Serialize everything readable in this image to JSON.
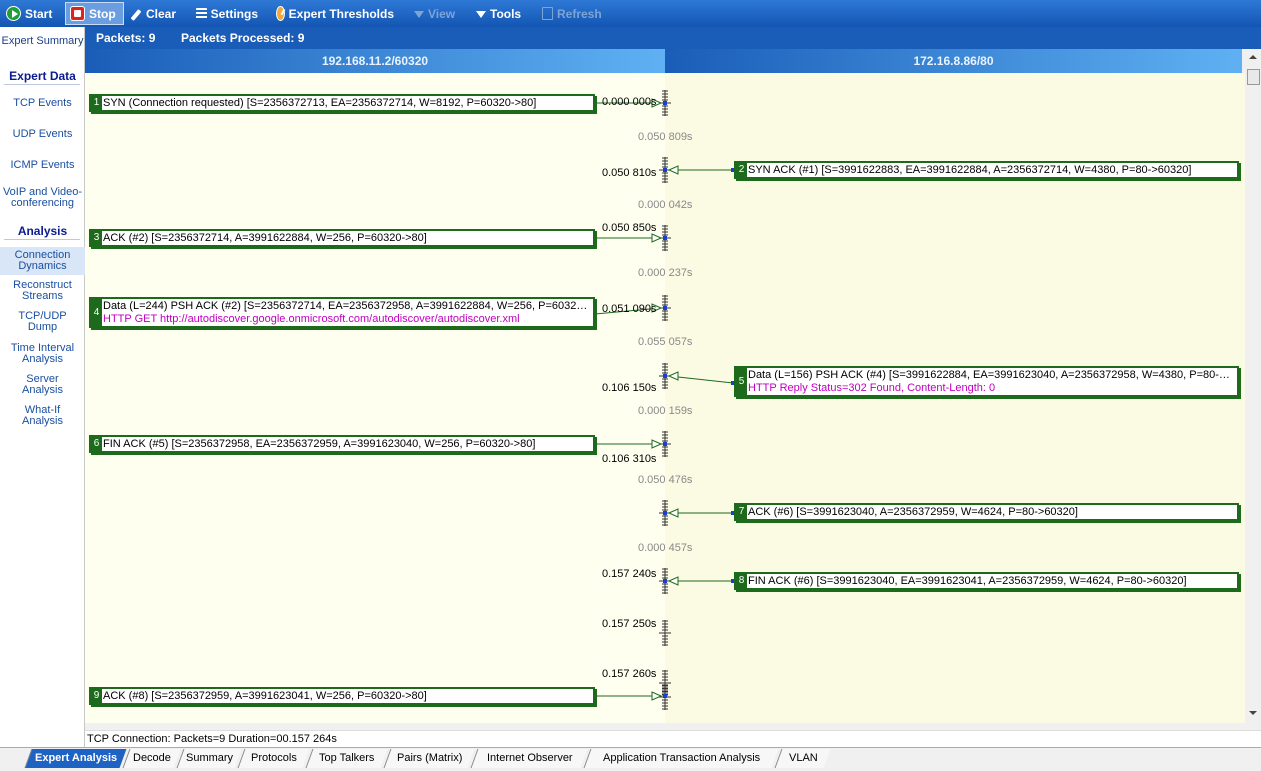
{
  "toolbar": {
    "start": "Start",
    "stop": "Stop",
    "clear": "Clear",
    "settings": "Settings",
    "expert_thresholds": "Expert Thresholds",
    "view": "View",
    "tools": "Tools",
    "refresh": "Refresh"
  },
  "sidebar": {
    "expert_summary": "Expert Summary",
    "expert_data_header": "Expert Data",
    "tcp_events": "TCP Events",
    "udp_events": "UDP Events",
    "icmp_events": "ICMP Events",
    "voip_line1": "VoIP and Video-",
    "voip_line2": "conferencing",
    "analysis_header": "Analysis",
    "conn_dyn_line1": "Connection",
    "conn_dyn_line2": "Dynamics",
    "reconstruct_line1": "Reconstruct",
    "reconstruct_line2": "Streams",
    "tcpudp_line1": "TCP/UDP",
    "tcpudp_line2": "Dump",
    "time_interval_line1": "Time Interval",
    "time_interval_line2": "Analysis",
    "server_line1": "Server",
    "server_line2": "Analysis",
    "whatif_line1": "What-If",
    "whatif_line2": "Analysis"
  },
  "info": {
    "packets": "Packets: 9",
    "packets_processed": "Packets Processed: 9"
  },
  "hosts": {
    "left": "192.168.11.2/60320",
    "right": "172.16.8.86/80"
  },
  "packets": [
    {
      "num": "1",
      "text": "SYN (Connection requested) [S=2356372713, EA=2356372714, W=8192, P=60320->80]",
      "detail": ""
    },
    {
      "num": "2",
      "text": "SYN ACK (#1) [S=3991622883, EA=3991622884, A=2356372714, W=4380, P=80->60320]",
      "detail": ""
    },
    {
      "num": "3",
      "text": "ACK (#2) [S=2356372714, A=3991622884, W=256, P=60320->80]",
      "detail": ""
    },
    {
      "num": "4",
      "text": "Data (L=244) PSH ACK (#2) [S=2356372714, EA=2356372958, A=3991622884, W=256, P=60320->...",
      "detail": "HTTP GET http://autodiscover.google.onmicrosoft.com/autodiscover/autodiscover.xml"
    },
    {
      "num": "5",
      "text": "Data (L=156) PSH ACK (#4) [S=3991622884, EA=3991623040, A=2356372958, W=4380, P=80->60...",
      "detail": "HTTP Reply Status=302 Found, Content-Length: 0"
    },
    {
      "num": "6",
      "text": "FIN ACK (#5) [S=2356372958, EA=2356372959, A=3991623040, W=256, P=60320->80]",
      "detail": ""
    },
    {
      "num": "7",
      "text": "ACK (#6) [S=3991623040, A=2356372959, W=4624, P=80->60320]",
      "detail": ""
    },
    {
      "num": "8",
      "text": "FIN ACK (#6) [S=3991623040, EA=3991623041, A=2356372959, W=4624, P=80->60320]",
      "detail": ""
    },
    {
      "num": "9",
      "text": "ACK (#8) [S=2356372959, A=3991623041, W=256, P=60320->80]",
      "detail": ""
    }
  ],
  "timestamps": {
    "t1": "0.000 000s",
    "t2": "0.050 810s",
    "t3": "0.050 850s",
    "t4": "0.051 090s",
    "t5": "0.106 150s",
    "t6": "0.106 310s",
    "t8": "0.157 240s",
    "t8b": "0.157 250s",
    "t8c": "0.157 260s"
  },
  "deltas": {
    "d1": "0.050 809s",
    "d2": "0.000 042s",
    "d3": "0.000 237s",
    "d4": "0.055 057s",
    "d5": "0.000 159s",
    "d6": "0.050 476s",
    "d7": "0.000 457s"
  },
  "status": "TCP Connection: Packets=9 Duration=00.157 264s",
  "tabs": [
    "Expert Analysis",
    "Decode",
    "Summary",
    "Protocols",
    "Top Talkers",
    "Pairs (Matrix)",
    "Internet Observer",
    "Application Transaction Analysis",
    "VLAN"
  ],
  "colors": {
    "toolbar": "#1a5db8",
    "packet_border": "#1d6a1d",
    "detail_text": "#c000c0",
    "left_lane": "#fffff0",
    "right_lane": "#fbfbe4"
  }
}
